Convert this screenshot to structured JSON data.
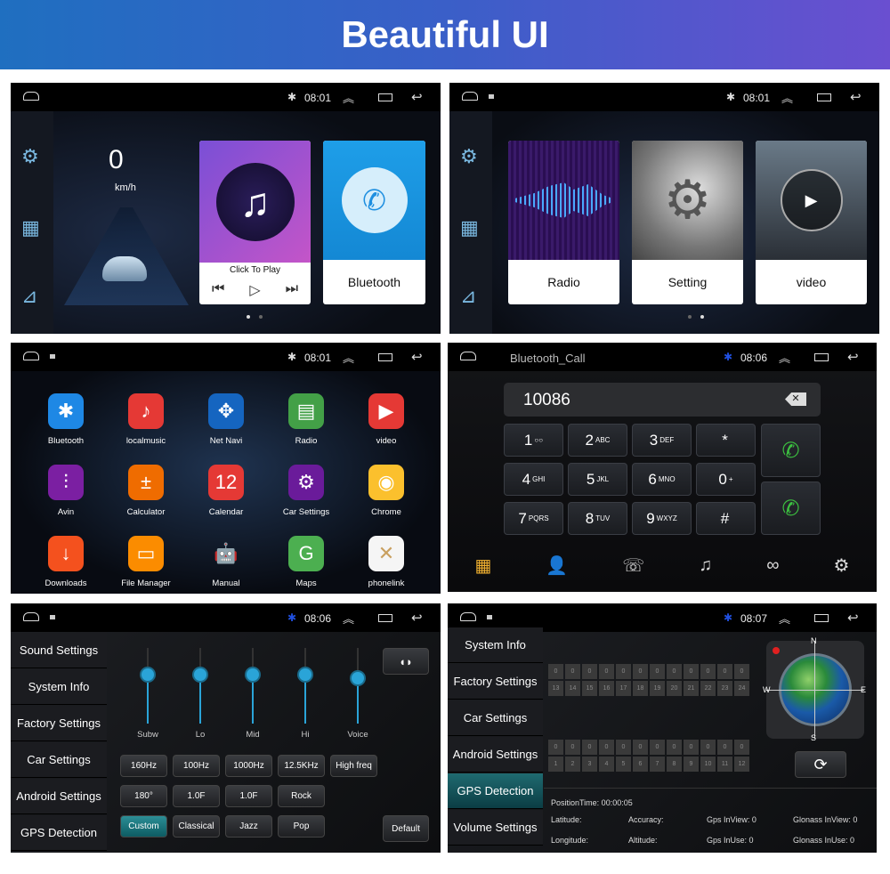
{
  "banner": {
    "title": "Beautiful UI"
  },
  "colors": {
    "banner_start": "#1f6fc0",
    "banner_end": "#6a4fd0",
    "accent": "#2aa4d8",
    "active_teal": "#1f6a70"
  },
  "screens": {
    "home1": {
      "time": "08:01",
      "speed": "0",
      "speed_unit": "km/h",
      "music_caption": "Click To Play",
      "bluetooth_label": "Bluetooth",
      "page": 1,
      "pages": 2
    },
    "home2": {
      "time": "08:01",
      "cards": [
        {
          "label": "Radio",
          "icon": "sound-wave"
        },
        {
          "label": "Setting",
          "icon": "gears"
        },
        {
          "label": "video",
          "icon": "play"
        }
      ],
      "page": 2,
      "pages": 2
    },
    "apps": {
      "time": "08:01",
      "items": [
        {
          "label": "Bluetooth",
          "icon": "bluetooth-icon",
          "color": "#1e88e5",
          "glyph": "✱"
        },
        {
          "label": "localmusic",
          "icon": "music-icon",
          "color": "#e53935",
          "glyph": "♪"
        },
        {
          "label": "Net Navi",
          "icon": "compass-icon",
          "color": "#1565c0",
          "glyph": "✥"
        },
        {
          "label": "Radio",
          "icon": "radio-icon",
          "color": "#43a047",
          "glyph": "▤"
        },
        {
          "label": "video",
          "icon": "video-icon",
          "color": "#e53935",
          "glyph": "▶"
        },
        {
          "label": "Avin",
          "icon": "equalizer-icon",
          "color": "#7b1fa2",
          "glyph": "⫶"
        },
        {
          "label": "Calculator",
          "icon": "calculator-icon",
          "color": "#ef6c00",
          "glyph": "±"
        },
        {
          "label": "Calendar",
          "icon": "calendar-icon",
          "color": "#e53935",
          "glyph": "12"
        },
        {
          "label": "Car Settings",
          "icon": "gear-icon",
          "color": "#6a1b9a",
          "glyph": "⚙"
        },
        {
          "label": "Chrome",
          "icon": "chrome-icon",
          "color": "#fbc02d",
          "glyph": "◉"
        },
        {
          "label": "Downloads",
          "icon": "download-icon",
          "color": "#f4511e",
          "glyph": "↓"
        },
        {
          "label": "File Manager",
          "icon": "folder-icon",
          "color": "#fb8c00",
          "glyph": "▭"
        },
        {
          "label": "Manual",
          "icon": "android-icon",
          "color": "transparent",
          "glyph": "🤖"
        },
        {
          "label": "Maps",
          "icon": "maps-icon",
          "color": "#4caf50",
          "glyph": "G"
        },
        {
          "label": "phonelink",
          "icon": "phonelink-icon",
          "color": "#f5f5f5",
          "glyph": "✕"
        }
      ]
    },
    "dialer": {
      "title": "Bluetooth_Call",
      "time": "08:06",
      "number": "10086",
      "keys": [
        {
          "d": "1",
          "s": "○○"
        },
        {
          "d": "2",
          "s": "ABC"
        },
        {
          "d": "3",
          "s": "DEF"
        },
        {
          "d": "*",
          "s": ""
        },
        {
          "d": "4",
          "s": "GHI"
        },
        {
          "d": "5",
          "s": "JKL"
        },
        {
          "d": "6",
          "s": "MNO"
        },
        {
          "d": "0",
          "s": "+"
        },
        {
          "d": "7",
          "s": "PQRS"
        },
        {
          "d": "8",
          "s": "TUV"
        },
        {
          "d": "9",
          "s": "WXYZ"
        },
        {
          "d": "#",
          "s": ""
        }
      ],
      "toolbar": [
        "keypad",
        "contacts",
        "call-log",
        "music",
        "link",
        "settings"
      ]
    },
    "eq": {
      "time": "08:06",
      "menu": [
        "Sound Settings",
        "System Info",
        "Factory Settings",
        "Car Settings",
        "Android Settings",
        "GPS Detection"
      ],
      "bands": [
        {
          "label": "Subw",
          "level": 0.65
        },
        {
          "label": "Lo",
          "level": 0.65
        },
        {
          "label": "Mid",
          "level": 0.65
        },
        {
          "label": "Hi",
          "level": 0.65
        },
        {
          "label": "Voice",
          "level": 0.6
        }
      ],
      "freq_buttons": [
        "160Hz",
        "100Hz",
        "1000Hz",
        "12.5KHz",
        "High freq"
      ],
      "param_buttons": [
        "180°",
        "1.0F",
        "1.0F",
        "Rock"
      ],
      "preset_buttons": [
        "Custom",
        "Classical",
        "Jazz",
        "Pop"
      ],
      "active_preset": "Custom",
      "default_label": "Default"
    },
    "gps": {
      "time": "08:07",
      "menu": [
        "System Info",
        "Factory Settings",
        "Car Settings",
        "Android Settings",
        "GPS Detection",
        "Volume Settings"
      ],
      "active": "GPS Detection",
      "top_values": [
        "0",
        "0",
        "0",
        "0",
        "0",
        "0",
        "0",
        "0",
        "0",
        "0",
        "0",
        "0"
      ],
      "top_ids": [
        "13",
        "14",
        "15",
        "16",
        "17",
        "18",
        "19",
        "20",
        "21",
        "22",
        "23",
        "24"
      ],
      "bottom_values": [
        "0",
        "0",
        "0",
        "0",
        "0",
        "0",
        "0",
        "0",
        "0",
        "0",
        "0",
        "0"
      ],
      "bottom_ids": [
        "1",
        "2",
        "3",
        "4",
        "5",
        "6",
        "7",
        "8",
        "9",
        "10",
        "11",
        "12"
      ],
      "compass": [
        "N",
        "E",
        "S",
        "W"
      ],
      "position_time": "PositionTime: 00:00:05",
      "fields": [
        "Latitude:",
        "Accuracy:",
        "Gps InView: 0",
        "Glonass InView: 0",
        "Longitude:",
        "Altitude:",
        "Gps InUse: 0",
        "Glonass InUse: 0"
      ]
    }
  }
}
